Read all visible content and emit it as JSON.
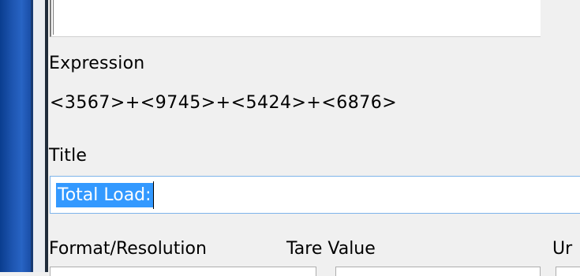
{
  "expression": {
    "label": "Expression",
    "value": "<3567>+<9745>+<5424>+<6876>"
  },
  "title": {
    "label": "Title",
    "value": "Total Load:"
  },
  "fields": {
    "format_label": "Format/Resolution",
    "tare_label": "Tare Value",
    "units_label": "Ur"
  }
}
